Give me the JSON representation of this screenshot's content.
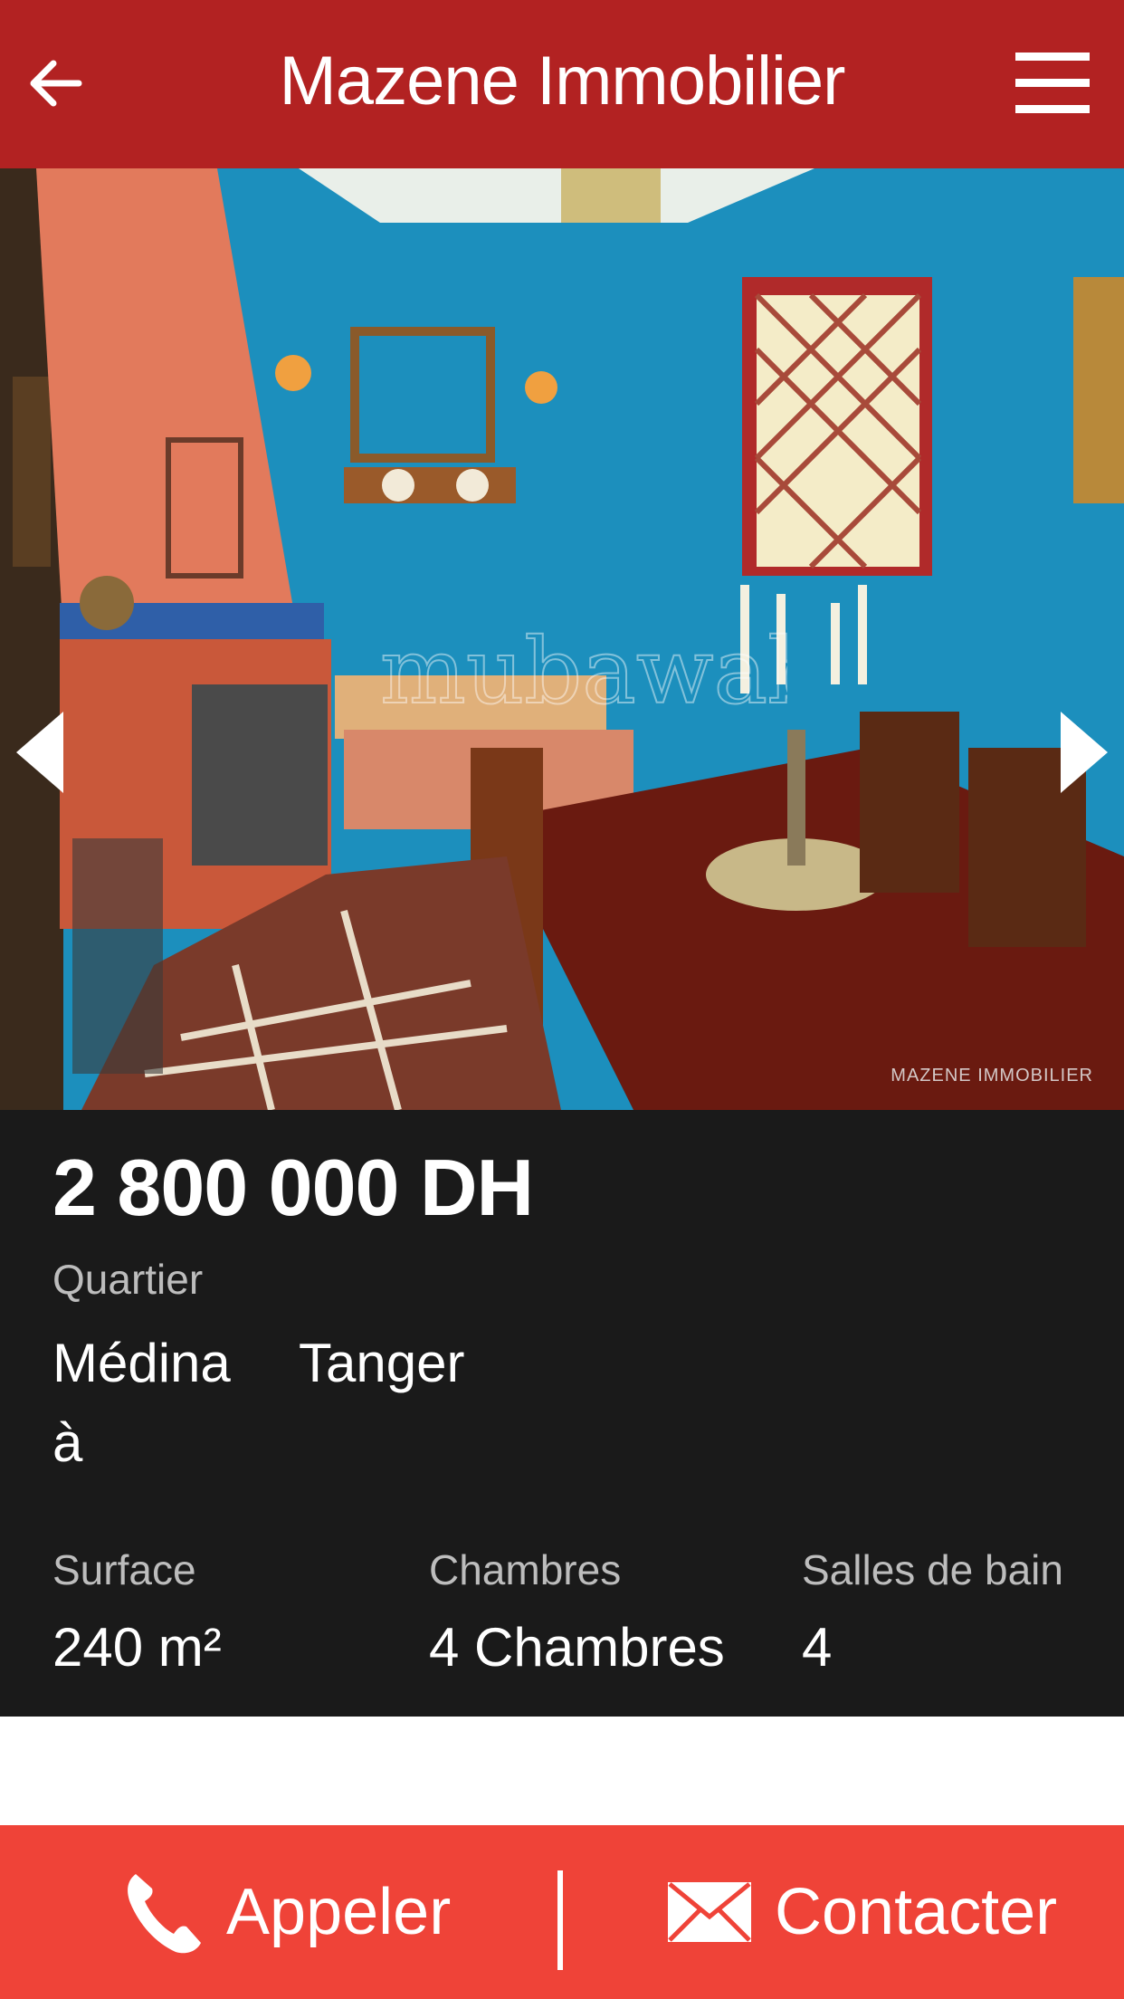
{
  "header": {
    "title": "Mazene Immobilier",
    "back_icon": "arrow-left-icon",
    "menu_icon": "hamburger-icon"
  },
  "gallery": {
    "watermark_center": "mubawab",
    "watermark_corner": "MAZENE IMMOBILIER",
    "prev_icon": "chevron-left-icon",
    "next_icon": "chevron-right-icon"
  },
  "listing": {
    "price": "2 800 000 DH",
    "quartier_label": "Quartier",
    "quartier_value": "Médina à",
    "city": "Tanger",
    "surface_label": "Surface",
    "surface_value": "240 m²",
    "chambres_label": "Chambres",
    "chambres_value": "4 Chambres",
    "salles_label": "Salles de bain",
    "salles_value": "4"
  },
  "footer": {
    "call_label": "Appeler",
    "contact_label": "Contacter",
    "call_icon": "phone-icon",
    "contact_icon": "envelope-icon"
  },
  "colors": {
    "header": "#b22222",
    "footer": "#ef4338",
    "info_panel": "#1a1a1a"
  }
}
